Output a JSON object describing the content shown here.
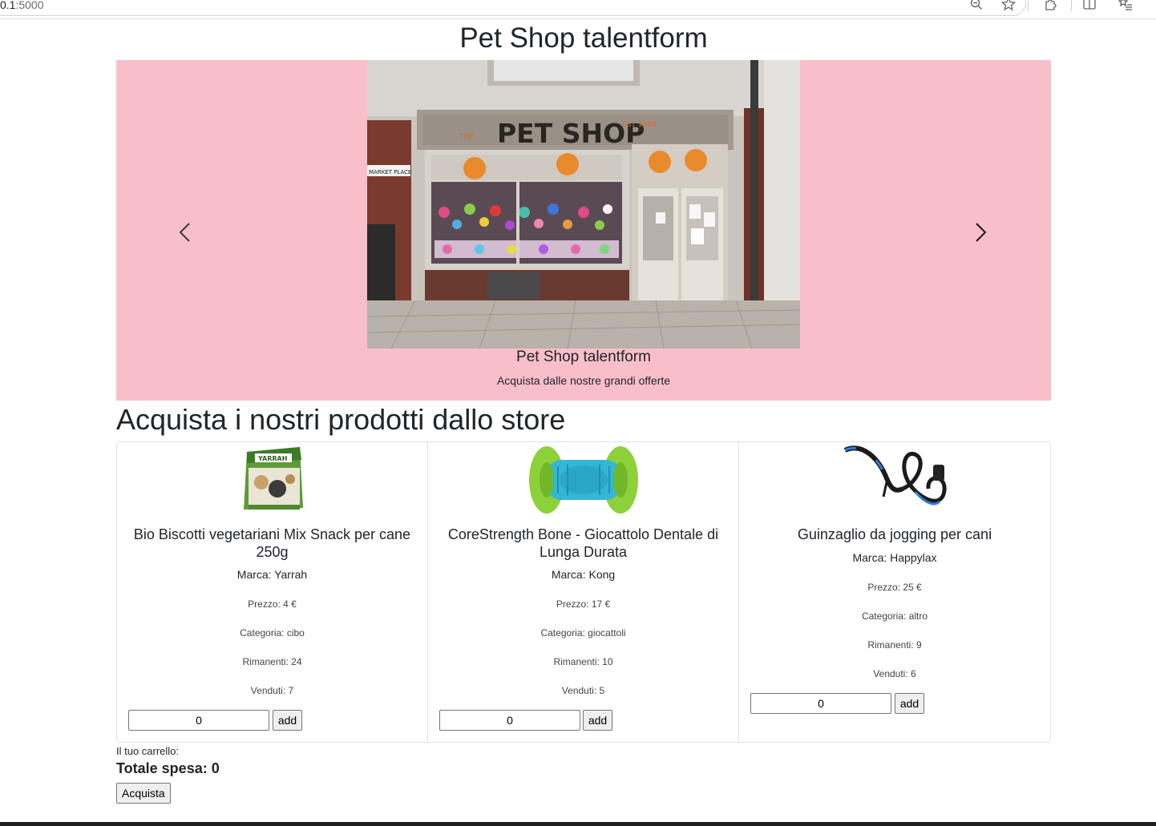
{
  "browser": {
    "url_host": "0.1",
    "url_port": ":5000",
    "icons": [
      "zoom-out-icon",
      "star-icon",
      "extensions-icon",
      "split-screen-icon",
      "favorites-icon"
    ]
  },
  "header": {
    "title": "Pet Shop talentform"
  },
  "carousel": {
    "background_color": "#f8bfcb",
    "caption_title": "Pet Shop talentform",
    "caption_subtitle": "Acquista dalle nostre grandi offerte",
    "photo_sign": "PET SHOP",
    "photo_sign_prefix": "THE",
    "photo_sign_suffix": "EST 1868",
    "photo_street_sign": "MARKET PLACE",
    "prev_icon": "chevron-left-icon",
    "next_icon": "chevron-right-icon"
  },
  "store": {
    "section_title": "Acquista i nostri prodotti dallo store",
    "products": [
      {
        "name": "Bio Biscotti vegetariani Mix Snack per cane 250g",
        "brand": "Marca: Yarrah",
        "price": "Prezzo: 4 €",
        "category": "Categoria: cibo",
        "remaining": "Rimanenti: 24",
        "sold": "Venduti: 7",
        "quantity": "0",
        "add_label": "add",
        "image_label": "YARRAH"
      },
      {
        "name": "CoreStrength Bone - Giocattolo Dentale di Lunga Durata",
        "brand": "Marca: Kong",
        "price": "Prezzo: 17 €",
        "category": "Categoria: giocattoli",
        "remaining": "Rimanenti: 10",
        "sold": "Venduti: 5",
        "quantity": "0",
        "add_label": "add"
      },
      {
        "name": "Guinzaglio da jogging per cani",
        "brand": "Marca: Happylax",
        "price": "Prezzo: 25 €",
        "category": "Categoria: altro",
        "remaining": "Rimanenti: 9",
        "sold": "Venduti: 6",
        "quantity": "0",
        "add_label": "add"
      }
    ]
  },
  "cart": {
    "label": "Il tuo carrello:",
    "total": "Totale spesa: 0",
    "buy_label": "Acquista"
  }
}
